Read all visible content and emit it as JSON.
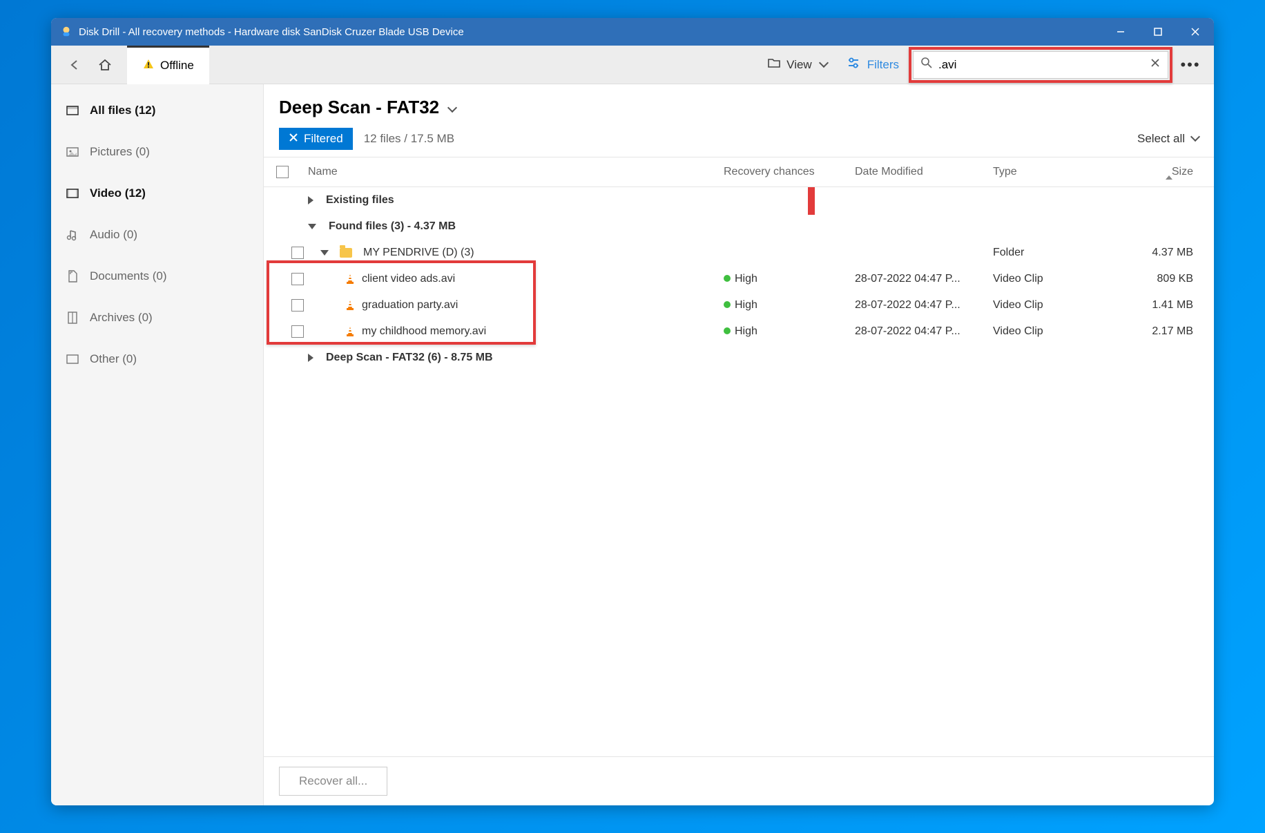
{
  "titlebar": {
    "title": "Disk Drill - All recovery methods - Hardware disk SanDisk Cruzer Blade USB Device"
  },
  "toolbar": {
    "tab_label": "Offline",
    "view_label": "View",
    "filters_label": "Filters",
    "search_value": ".avi"
  },
  "sidebar": {
    "items": [
      {
        "label": "All files (12)"
      },
      {
        "label": "Pictures (0)"
      },
      {
        "label": "Video (12)"
      },
      {
        "label": "Audio (0)"
      },
      {
        "label": "Documents (0)"
      },
      {
        "label": "Archives (0)"
      },
      {
        "label": "Other (0)"
      }
    ]
  },
  "main": {
    "scan_title": "Deep Scan - FAT32",
    "filtered_label": "Filtered",
    "file_count": "12 files / 17.5 MB",
    "select_all_label": "Select all"
  },
  "columns": {
    "name": "Name",
    "recovery": "Recovery chances",
    "date": "Date Modified",
    "type": "Type",
    "size": "Size"
  },
  "groups": {
    "existing": "Existing files",
    "found": "Found files (3) - 4.37 MB",
    "pendrive": "MY PENDRIVE (D) (3)",
    "pendrive_type": "Folder",
    "pendrive_size": "4.37 MB",
    "deepscan": "Deep Scan - FAT32 (6) - 8.75 MB"
  },
  "files": [
    {
      "name": "client video ads.avi",
      "recovery": "High",
      "date": "28-07-2022 04:47 P...",
      "type": "Video Clip",
      "size": "809 KB"
    },
    {
      "name": "graduation party.avi",
      "recovery": "High",
      "date": "28-07-2022 04:47 P...",
      "type": "Video Clip",
      "size": "1.41 MB"
    },
    {
      "name": "my childhood memory.avi",
      "recovery": "High",
      "date": "28-07-2022 04:47 P...",
      "type": "Video Clip",
      "size": "2.17 MB"
    }
  ],
  "footer": {
    "recover_label": "Recover all..."
  }
}
